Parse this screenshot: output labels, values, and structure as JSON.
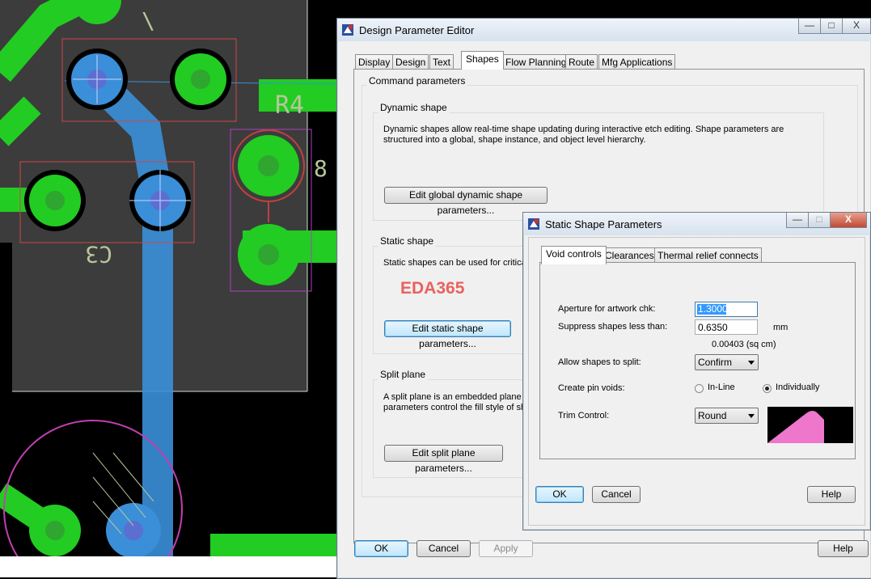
{
  "design_param_editor": {
    "title": "Design Parameter Editor",
    "window_buttons": {
      "minimize": "—",
      "maximize": "□",
      "close": "X"
    },
    "tabs": [
      {
        "label": "Display"
      },
      {
        "label": "Design"
      },
      {
        "label": "Text"
      },
      {
        "label": "Shapes"
      },
      {
        "label": "Flow Planning"
      },
      {
        "label": "Route"
      },
      {
        "label": "Mfg Applications"
      }
    ],
    "active_tab": "Shapes",
    "command_parameters_label": "Command parameters",
    "dynamic_shape": {
      "label": "Dynamic shape",
      "description_line1": "Dynamic shapes allow real-time shape updating during interactive etch editing.  Shape parameters are",
      "description_line2": "structured into a global, shape instance, and object level hierarchy.",
      "button": "Edit global dynamic shape parameters..."
    },
    "static_shape": {
      "label": "Static shape",
      "description_line1": "Static shapes can be used for critica",
      "button": "Edit static shape parameters..."
    },
    "split_plane": {
      "label": "Split plane",
      "description_line1": "A split plane is an embedded plane w",
      "description_line2": "parameters control the fill style of sha",
      "button": "Edit split plane parameters..."
    },
    "watermark": "EDA365",
    "buttons": {
      "ok": "OK",
      "cancel": "Cancel",
      "apply": "Apply",
      "help": "Help"
    }
  },
  "static_shape_params": {
    "title": "Static Shape Parameters",
    "window_buttons": {
      "minimize": "—",
      "maximize": "□",
      "close": "X"
    },
    "tabs": [
      {
        "label": "Void controls"
      },
      {
        "label": "Clearances"
      },
      {
        "label": "Thermal relief connects"
      }
    ],
    "active_tab": "Void controls",
    "aperture_label": "Aperture for artwork chk:",
    "aperture_value": "1.3000",
    "suppress_label": "Suppress shapes less than:",
    "suppress_value": "0.6350",
    "suppress_unit": "mm",
    "suppress_area": "0.00403 (sq cm)",
    "allow_split_label": "Allow shapes to split:",
    "allow_split_value": "Confirm",
    "pin_voids_label": "Create pin voids:",
    "pin_voids_options": [
      {
        "label": "In-Line",
        "selected": false
      },
      {
        "label": "Individually",
        "selected": true
      }
    ],
    "trim_control_label": "Trim Control:",
    "trim_control_value": "Round",
    "buttons": {
      "ok": "OK",
      "cancel": "Cancel",
      "help": "Help"
    }
  },
  "pcb": {
    "silkscreen_labels": [
      "R4",
      "C3",
      "8"
    ]
  },
  "colors": {
    "pad_green": "#22cc22",
    "via_blue": "#3a8fd8",
    "board_gray": "#3c3c3c",
    "preview_pink": "#ee77cc",
    "watermark_red": "#e8625f"
  }
}
